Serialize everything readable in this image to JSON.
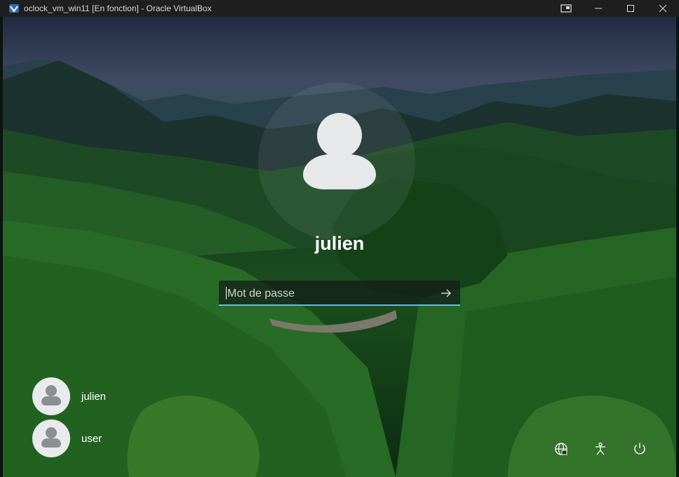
{
  "window": {
    "title": "oclock_vm_win11 [En fonction] - Oracle VirtualBox",
    "controls": [
      "vm-settings-icon",
      "minimize-icon",
      "maximize-icon",
      "close-icon"
    ]
  },
  "lockscreen": {
    "username": "julien",
    "password_placeholder": "Mot de passe",
    "submit_icon": "arrow-right-icon",
    "accent_color": "#4cc2ff"
  },
  "users": [
    {
      "name": "julien",
      "icon": "user-avatar-icon"
    },
    {
      "name": "user",
      "icon": "user-avatar-icon"
    }
  ],
  "system_icons": [
    "network-icon",
    "accessibility-icon",
    "power-icon"
  ]
}
